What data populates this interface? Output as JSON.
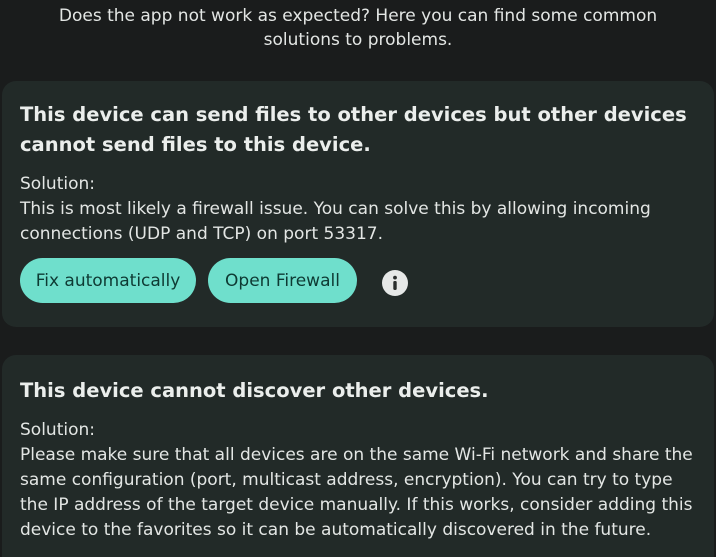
{
  "intro": {
    "text": "Does the app not work as expected? Here you can find some common solutions to problems."
  },
  "cards": [
    {
      "title": "This device can send files to other devices but other devices cannot send files to this device.",
      "solution_label": "Solution:",
      "solution_text": "This is most likely a firewall issue. You can solve this by allowing incoming connections (UDP and TCP) on port 53317.",
      "buttons": {
        "fix_label": "Fix automatically",
        "firewall_label": "Open Firewall"
      },
      "info_icon": "info-icon"
    },
    {
      "title": "This device cannot discover other devices.",
      "solution_label": "Solution:",
      "solution_text": "Please make sure that all devices are on the same Wi-Fi network and share the same configuration (port, multicast address, encryption). You can try to type the IP address of the target device manually. If this works, consider adding this device to the favorites so it can be automatically discovered in the future."
    }
  ],
  "colors": {
    "background": "#1a1c1c",
    "card": "#222a28",
    "accent": "#6fdfcc",
    "accent_text": "#0e3a33"
  }
}
